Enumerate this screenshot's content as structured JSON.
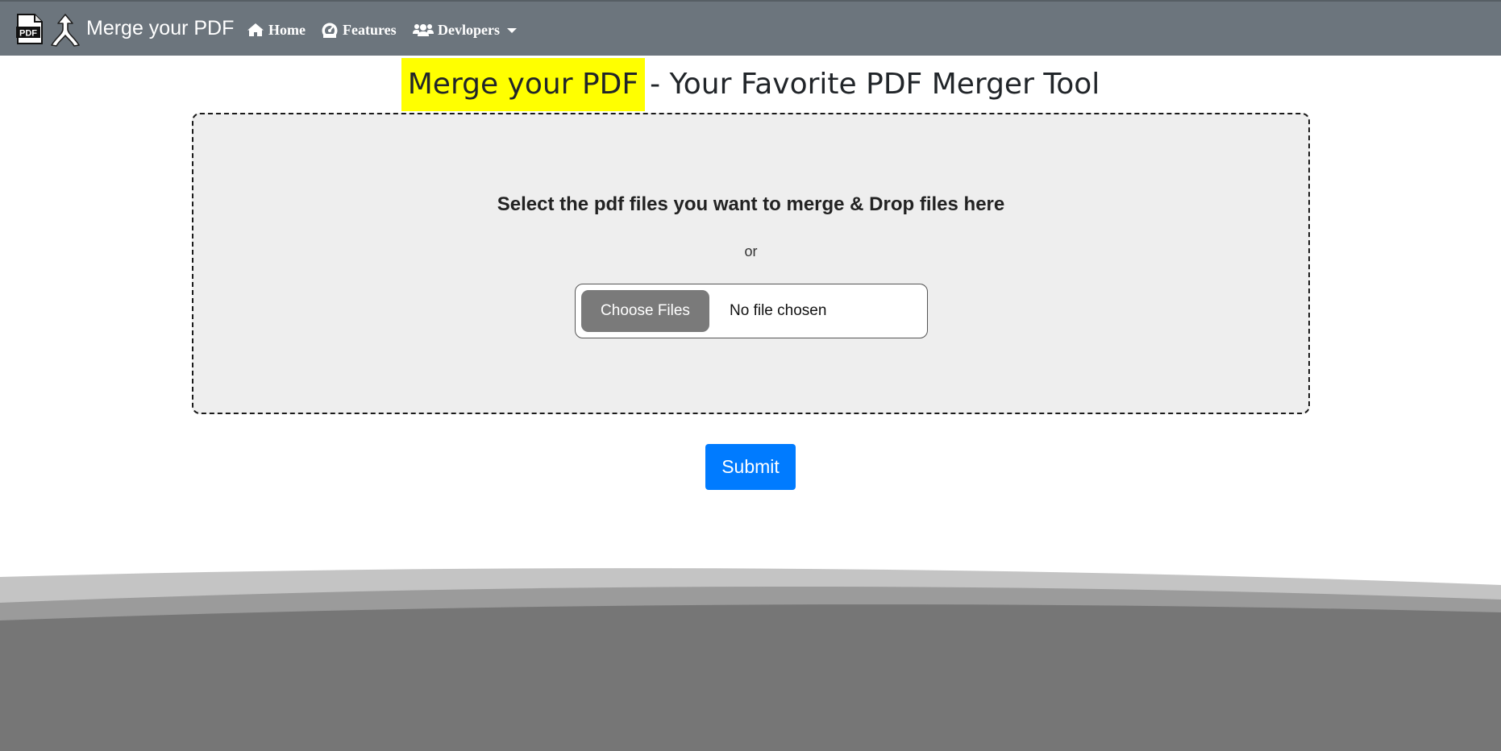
{
  "navbar": {
    "brand": "Merge your PDF",
    "pdf_logo_label": "PDF",
    "items": [
      {
        "label": "Home",
        "icon": "home-icon"
      },
      {
        "label": "Features",
        "icon": "gauge-icon"
      },
      {
        "label": "Devlopers",
        "icon": "users-icon",
        "dropdown": true
      }
    ],
    "background_color": "#6c757d"
  },
  "heading": {
    "highlight": "Merge your PDF",
    "rest": "- Your Favorite PDF Merger Tool",
    "highlight_color": "#ffff00"
  },
  "dropzone": {
    "title": "Select the pdf files you want to merge & Drop files here",
    "or_text": "or",
    "choose_button": "Choose Files",
    "file_status": "No file chosen"
  },
  "submit": {
    "label": "Submit",
    "color": "#007bff"
  }
}
